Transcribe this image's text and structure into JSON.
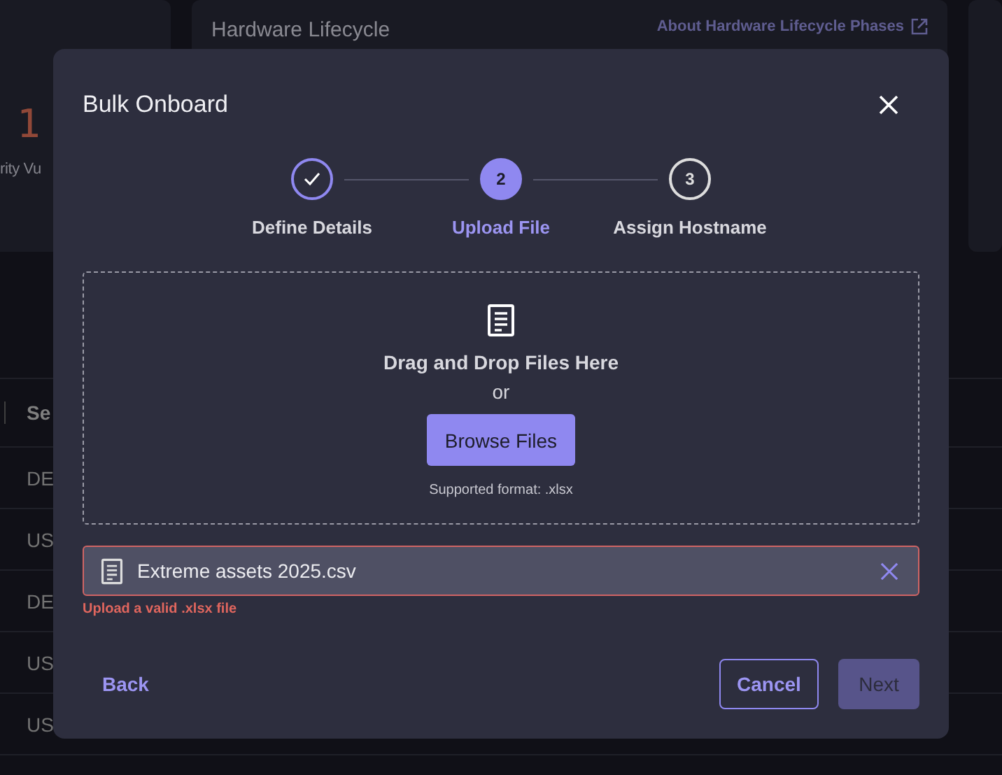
{
  "background": {
    "left_card": {
      "value": "1",
      "label": "rity Vu"
    },
    "lifecycle_card": {
      "title": "Hardware Lifecycle",
      "link": "About Hardware Lifecycle Phases"
    },
    "table": {
      "header": "Se",
      "rows": [
        "DE",
        "US",
        "DE",
        "US",
        "US"
      ]
    }
  },
  "modal": {
    "title": "Bulk Onboard",
    "steps": [
      {
        "label": "Define Details",
        "completed": true,
        "selected": false
      },
      {
        "label": "Upload File",
        "number": "2",
        "completed": false,
        "selected": true
      },
      {
        "label": "Assign Hostname",
        "number": "3",
        "completed": false,
        "selected": false
      }
    ],
    "dropzone": {
      "heading": "Drag and Drop Files Here",
      "or": "or",
      "button": "Browse Files",
      "hint": "Supported format: .xlsx"
    },
    "file": {
      "name": "Extreme assets 2025.csv",
      "invalid": true,
      "error": "Upload a valid .xlsx file"
    },
    "footer": {
      "back": "Back",
      "cancel": "Cancel",
      "next": {
        "label": "Next",
        "disabled": true
      }
    }
  }
}
